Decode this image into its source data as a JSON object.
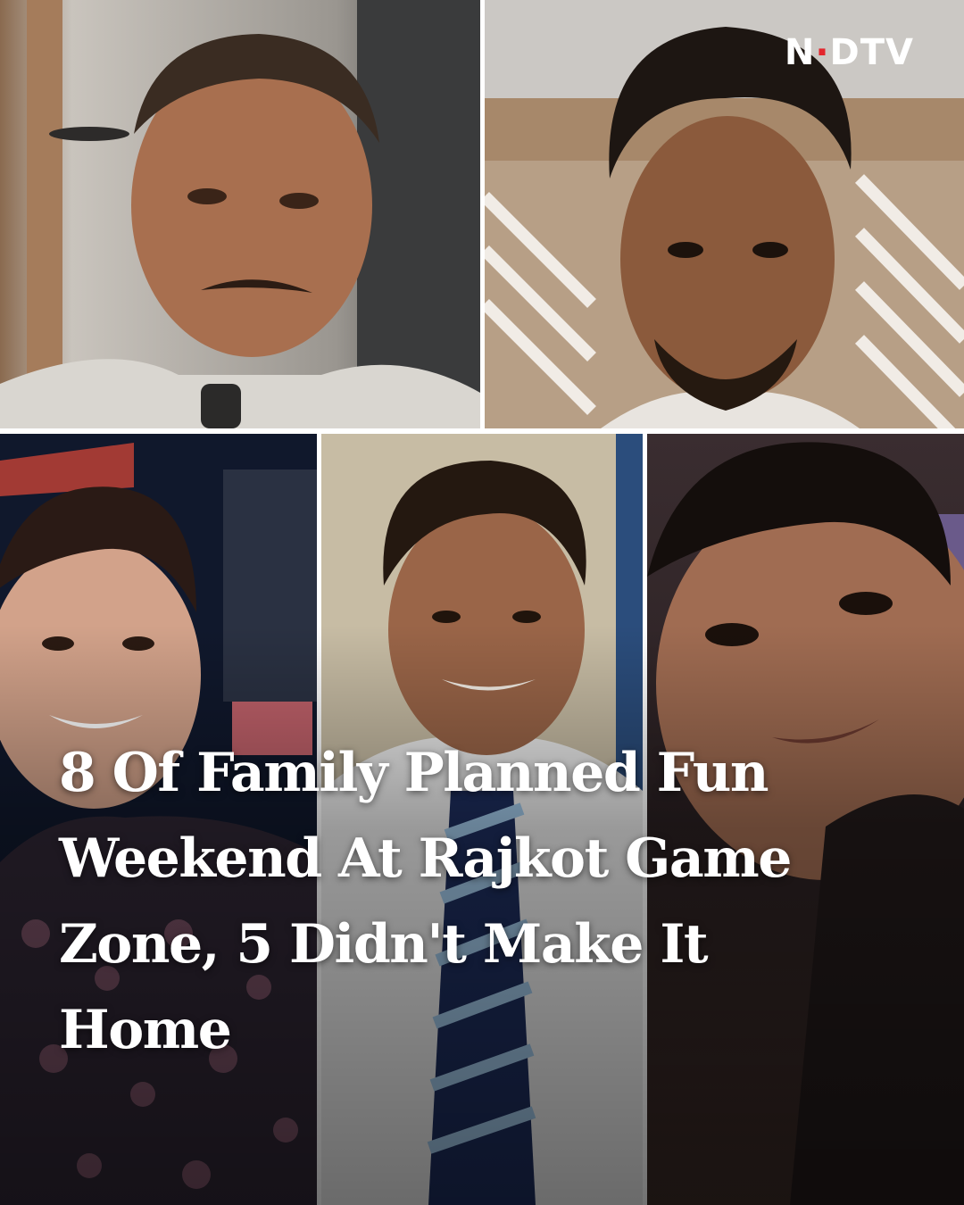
{
  "brand": {
    "logo_text": "NDTV",
    "accent_color": "#e3262d"
  },
  "headline": {
    "text": "8 Of Family Planned Fun Weekend At Rajkot Game Zone, 5 Didn't Make It Home",
    "color": "#ffffff"
  },
  "photos": [
    {
      "subject": "man-with-moustache-portrait"
    },
    {
      "subject": "young-man-with-beard-portrait"
    },
    {
      "subject": "young-woman-smiling-portrait"
    },
    {
      "subject": "boy-in-school-uniform-portrait"
    },
    {
      "subject": "child-close-up-portrait"
    }
  ]
}
